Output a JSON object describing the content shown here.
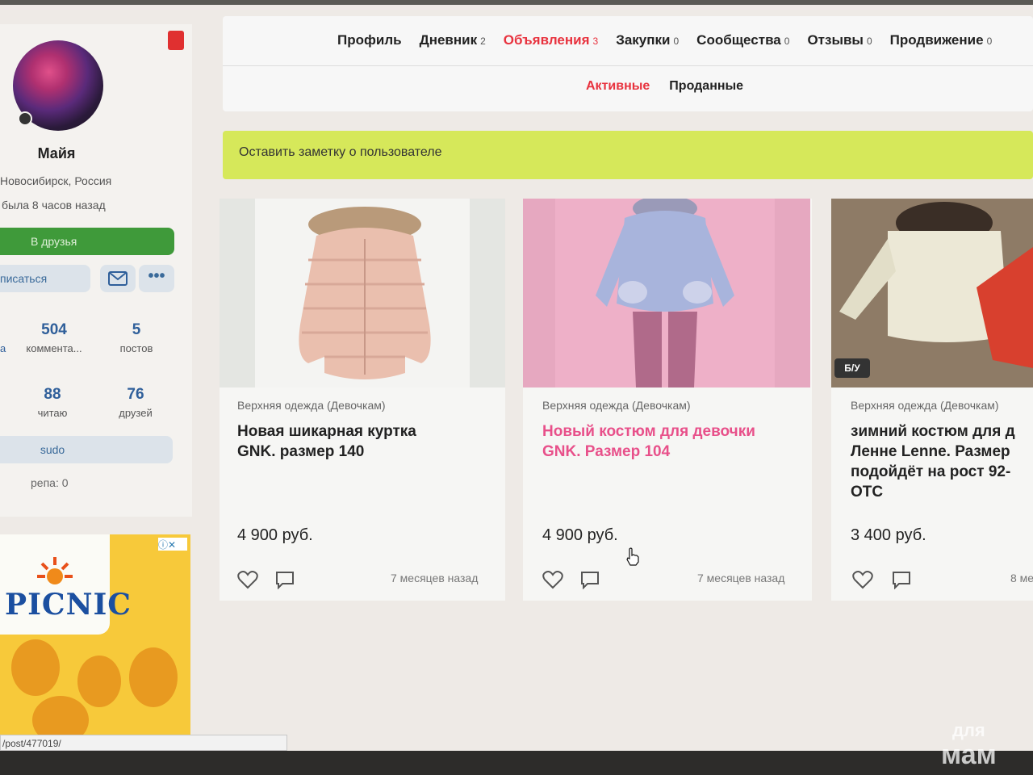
{
  "profile": {
    "name": "Майя",
    "location": "Новосибирск, Россия",
    "last_seen": "была 8 часов назад",
    "add_friend_label": "В друзья",
    "write_label": "писаться",
    "more_label": "•••",
    "stats": [
      {
        "value": "504",
        "label": "коммента..."
      },
      {
        "value": "5",
        "label": "постов"
      },
      {
        "value": "88",
        "label": "читаю"
      },
      {
        "value": "76",
        "label": "друзей"
      }
    ],
    "stats_partial_left_a": "а",
    "group": "sudo",
    "reputation": "репа: 0"
  },
  "ad": {
    "brand": "PICNIC",
    "info_close": "ⓘ✕"
  },
  "status_url": "/post/477019/",
  "nav": {
    "tabs": [
      {
        "label": "Профиль",
        "count": ""
      },
      {
        "label": "Дневник",
        "count": "2"
      },
      {
        "label": "Объявления",
        "count": "3"
      },
      {
        "label": "Закупки",
        "count": "0"
      },
      {
        "label": "Сообщества",
        "count": "0"
      },
      {
        "label": "Отзывы",
        "count": "0"
      },
      {
        "label": "Продвижение",
        "count": "0"
      }
    ],
    "active_tab": "Объявления",
    "subtabs": [
      "Активные",
      "Проданные"
    ],
    "active_subtab": "Активные"
  },
  "note": {
    "text": "Оставить заметку о пользователе"
  },
  "listings": [
    {
      "category": "Верхняя одежда (Девочкам)",
      "title_line1": "Новая шикарная куртка",
      "title_line2": "GNK. размер 140",
      "price": "4 900 руб.",
      "posted": "7 месяцев назад"
    },
    {
      "category": "Верхняя одежда (Девочкам)",
      "title_line1": "Новый костюм для девочки",
      "title_line2": "GNK. Размер 104",
      "price": "4 900 руб.",
      "posted": "7 месяцев назад"
    },
    {
      "category": "Верхняя одежда (Девочкам)",
      "title_line1": "зимний костюм для д",
      "title_line2": "Ленне Lenne. Размер",
      "title_line3": "подойдёт на рост 92-",
      "title_line4": "ОТС",
      "price": "3 400 руб.",
      "posted": "8 ме",
      "badge": "Б/У"
    }
  ],
  "watermark": {
    "line1": "для",
    "line2": "мам"
  },
  "colors": {
    "accent_red": "#e8323e",
    "pink_title": "#e8508a",
    "friend_green": "#3f9a3a",
    "note_yellow": "#d6e85a",
    "link_blue": "#2f5f9a"
  }
}
